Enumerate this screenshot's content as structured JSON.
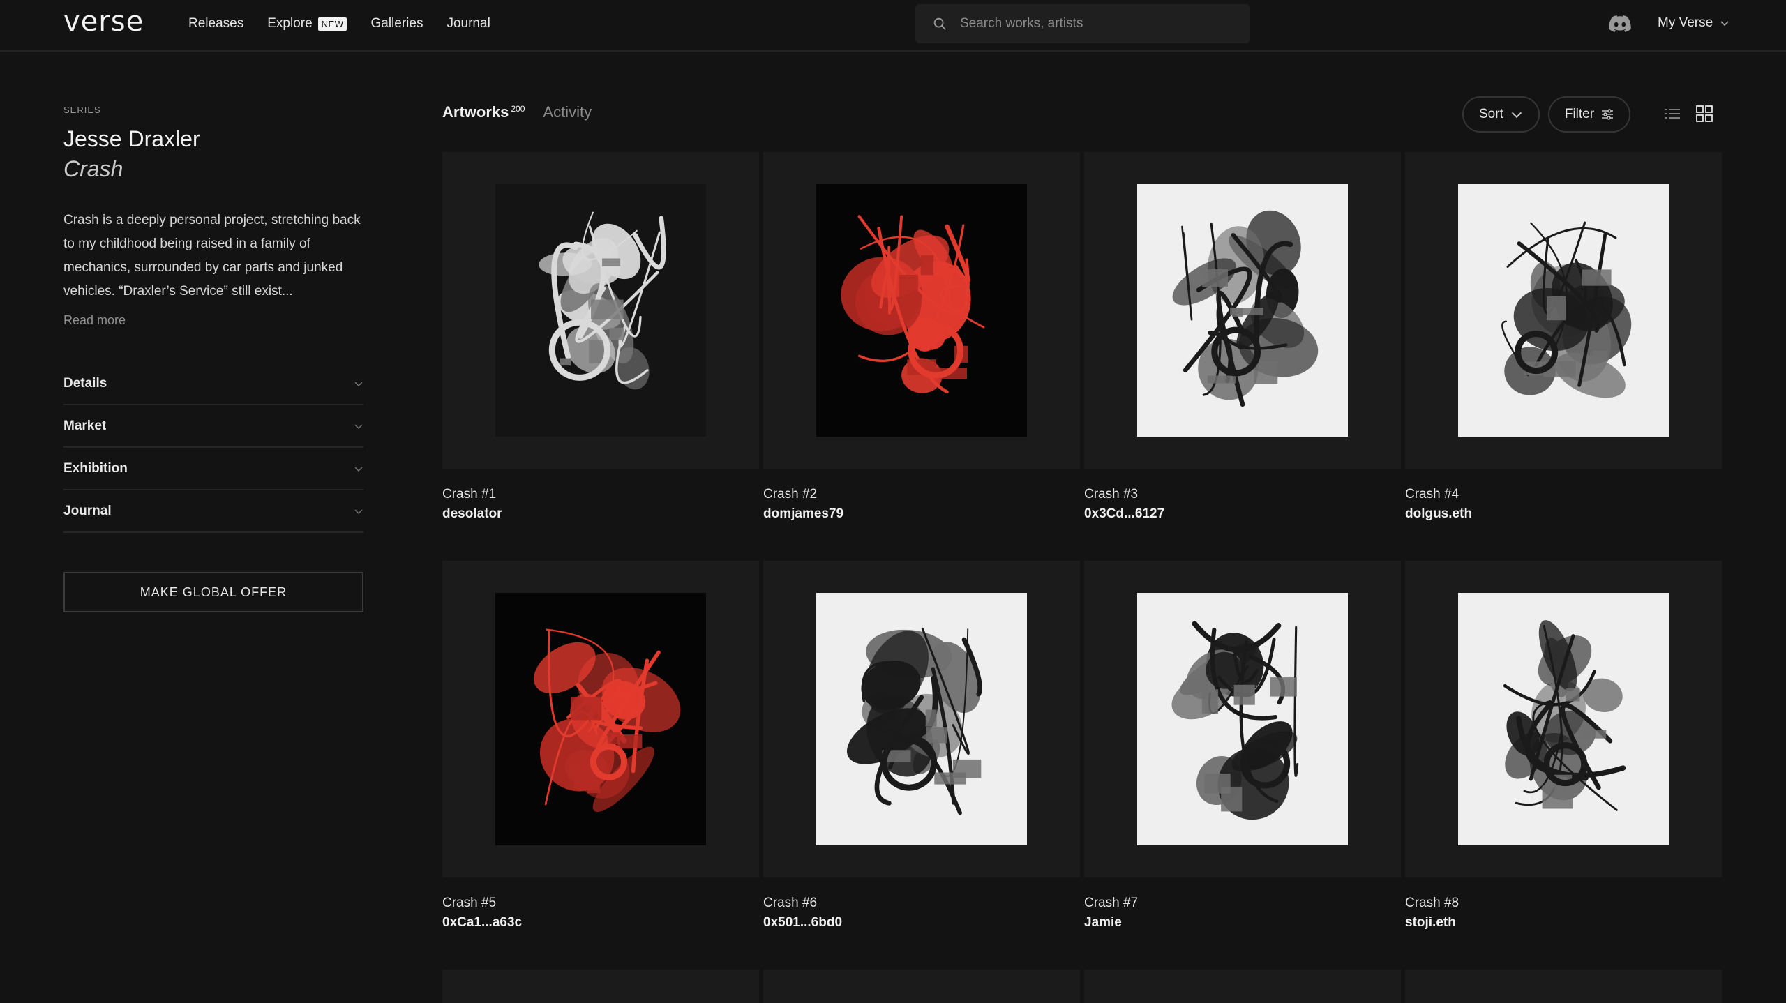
{
  "header": {
    "logo": "verse",
    "nav": [
      {
        "label": "Releases"
      },
      {
        "label": "Explore",
        "badge": "NEW"
      },
      {
        "label": "Galleries"
      },
      {
        "label": "Journal"
      }
    ],
    "search_placeholder": "Search works, artists",
    "account_label": "My Verse"
  },
  "sidebar": {
    "series_label": "SERIES",
    "artist": "Jesse Draxler",
    "title": "Crash",
    "description": "Crash is a deeply personal project, stretching back to my childhood being raised in a family of mechanics, surrounded by car parts and junked vehicles. “Draxler’s Service” still exist...",
    "read_more": "Read more",
    "accordion": [
      "Details",
      "Market",
      "Exhibition",
      "Journal"
    ],
    "offer_button": "MAKE GLOBAL OFFER"
  },
  "main": {
    "tabs": [
      {
        "label": "Artworks",
        "count": "200"
      },
      {
        "label": "Activity"
      }
    ],
    "sort_label": "Sort",
    "filter_label": "Filter",
    "artworks": [
      {
        "title": "Crash #1",
        "owner": "desolator",
        "style": "dark-gray"
      },
      {
        "title": "Crash #2",
        "owner": "domjames79",
        "style": "red-black"
      },
      {
        "title": "Crash #3",
        "owner": "0x3Cd...6127",
        "style": "light"
      },
      {
        "title": "Crash #4",
        "owner": "dolgus.eth",
        "style": "light"
      },
      {
        "title": "Crash #5",
        "owner": "0xCa1...a63c",
        "style": "red-black"
      },
      {
        "title": "Crash #6",
        "owner": "0x501...6bd0",
        "style": "light"
      },
      {
        "title": "Crash #7",
        "owner": "Jamie",
        "style": "light"
      },
      {
        "title": "Crash #8",
        "owner": "stoji.eth",
        "style": "light"
      }
    ]
  },
  "colors": {
    "background": "#131313",
    "card": "#1b1b1b",
    "accent_red": "#e33a2e"
  }
}
